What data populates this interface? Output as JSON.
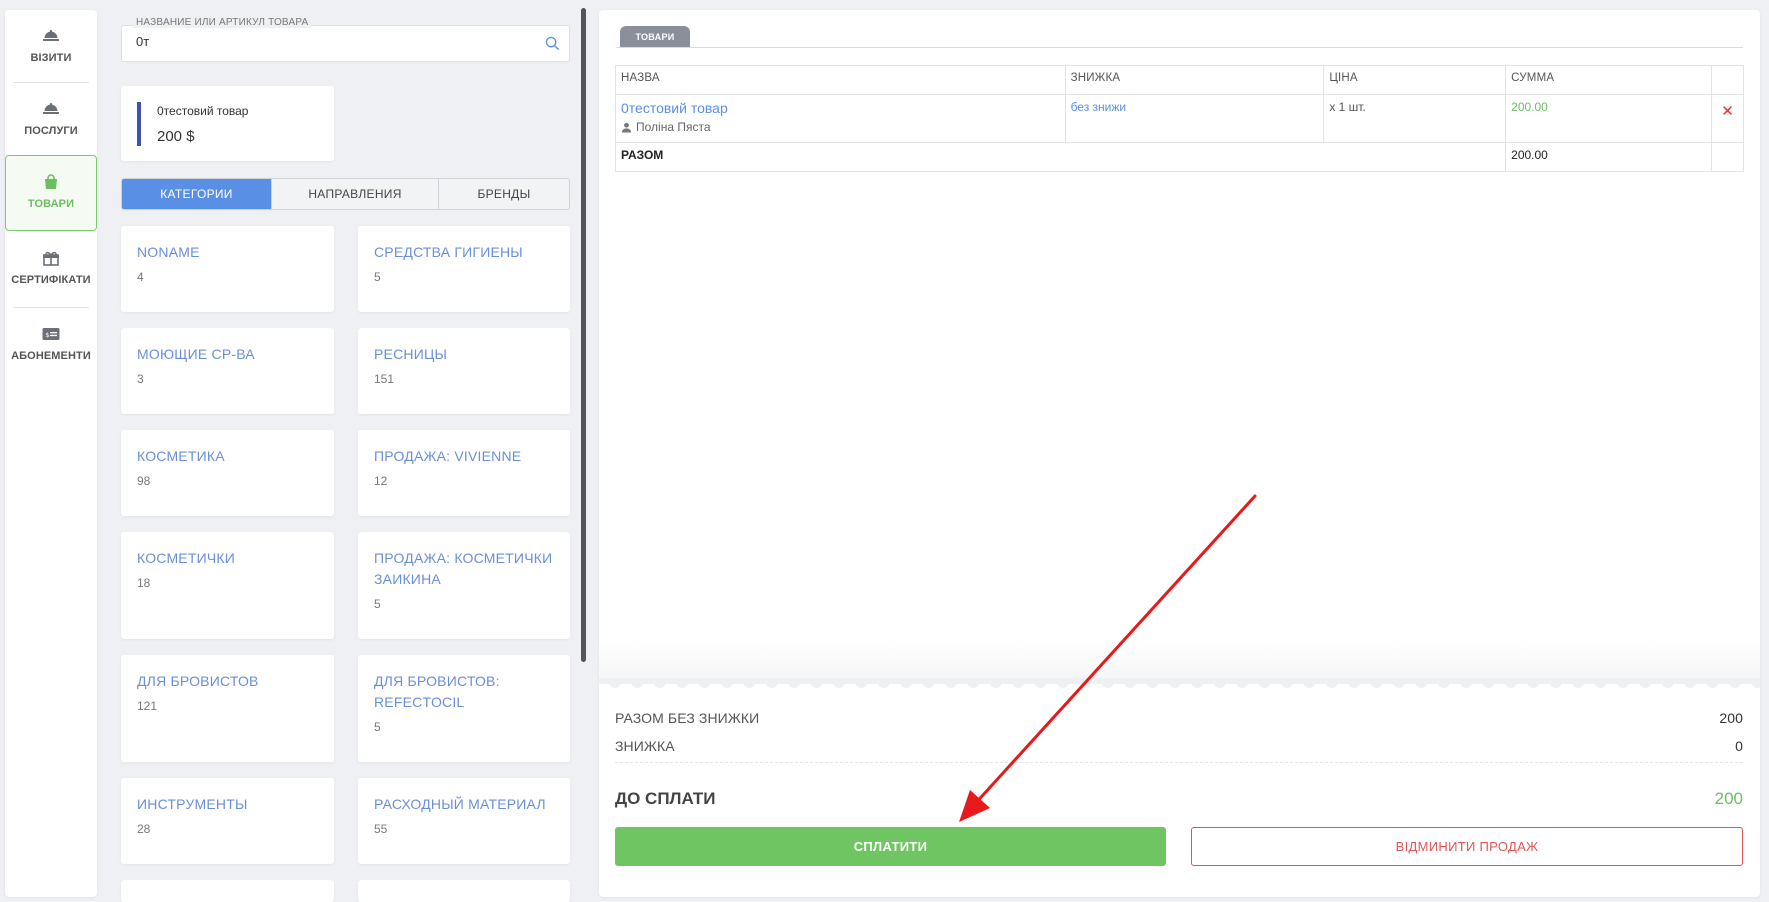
{
  "nav": {
    "items": [
      {
        "label": "ВІЗИТИ",
        "icon": "bell-icon"
      },
      {
        "label": "ПОСЛУГИ",
        "icon": "bell-icon"
      },
      {
        "label": "ТОВАРИ",
        "icon": "shopping-bag-icon",
        "active": true
      },
      {
        "label": "СЕРТИФІКАТИ",
        "icon": "gift-icon"
      },
      {
        "label": "АБОНЕМЕНТИ",
        "icon": "membership-card-icon"
      }
    ]
  },
  "search": {
    "label": "НАЗВАНИЕ ИЛИ АРТИКУЛ ТОВАРА",
    "value": "0т"
  },
  "product_card": {
    "name": "0тестовий товар",
    "price": "200 $"
  },
  "category_tabs": [
    {
      "label": "КАТЕГОРИИ",
      "active": true
    },
    {
      "label": "НАПРАВЛЕНИЯ",
      "active": false
    },
    {
      "label": "БРЕНДЫ",
      "active": false
    }
  ],
  "categories": [
    {
      "name": "NONAME",
      "count": "4"
    },
    {
      "name": "СРЕДСТВА ГИГИЕНЫ",
      "count": "5"
    },
    {
      "name": "МОЮЩИЕ СР-ВА",
      "count": "3"
    },
    {
      "name": "РЕСНИЦЫ",
      "count": "151"
    },
    {
      "name": "КОСМЕТИКА",
      "count": "98"
    },
    {
      "name": "ПРОДАЖА: VIVIENNE",
      "count": "12"
    },
    {
      "name": "КОСМЕТИЧКИ",
      "count": "18"
    },
    {
      "name": "ПРОДАЖА: КОСМЕТИЧКИ ЗАИКИНА",
      "count": "5"
    },
    {
      "name": "ДЛЯ БРОВИСТОВ",
      "count": "121"
    },
    {
      "name": "ДЛЯ БРОВИСТОВ: REFECTOCIL",
      "count": "5"
    },
    {
      "name": "ИНСТРУМЕНТЫ",
      "count": "28"
    },
    {
      "name": "РАСХОДНЫЙ МАТЕРИАЛ",
      "count": "55"
    }
  ],
  "cart": {
    "tab_label": "ТОВАРИ",
    "columns": {
      "name": "НАЗВА",
      "discount": "ЗНИЖКА",
      "price": "ЦІНА",
      "sum": "СУММА"
    },
    "items": [
      {
        "name": "0тестовий товар",
        "master": "Поліна Пяста",
        "discount": "без знижи",
        "qty": "x 1 шт.",
        "sum": "200.00",
        "remove": "✕"
      }
    ],
    "total_label": "РАЗОМ",
    "total_value": "200.00"
  },
  "summary": {
    "without_discount_label": "РАЗОМ БЕЗ ЗНИЖКИ",
    "without_discount_value": "200",
    "discount_label": "ЗНИЖКА",
    "discount_value": "0",
    "to_pay_label": "ДО СПЛАТИ",
    "to_pay_value": "200"
  },
  "actions": {
    "pay_label": "СПЛАТИТИ",
    "cancel_label": "ВІДМИНИТИ ПРОДАЖ"
  },
  "colors": {
    "accent_blue": "#5a8fe6",
    "accent_green": "#6fc562",
    "danger_red": "#e05555",
    "annotation_arrow": "#e8191b"
  }
}
